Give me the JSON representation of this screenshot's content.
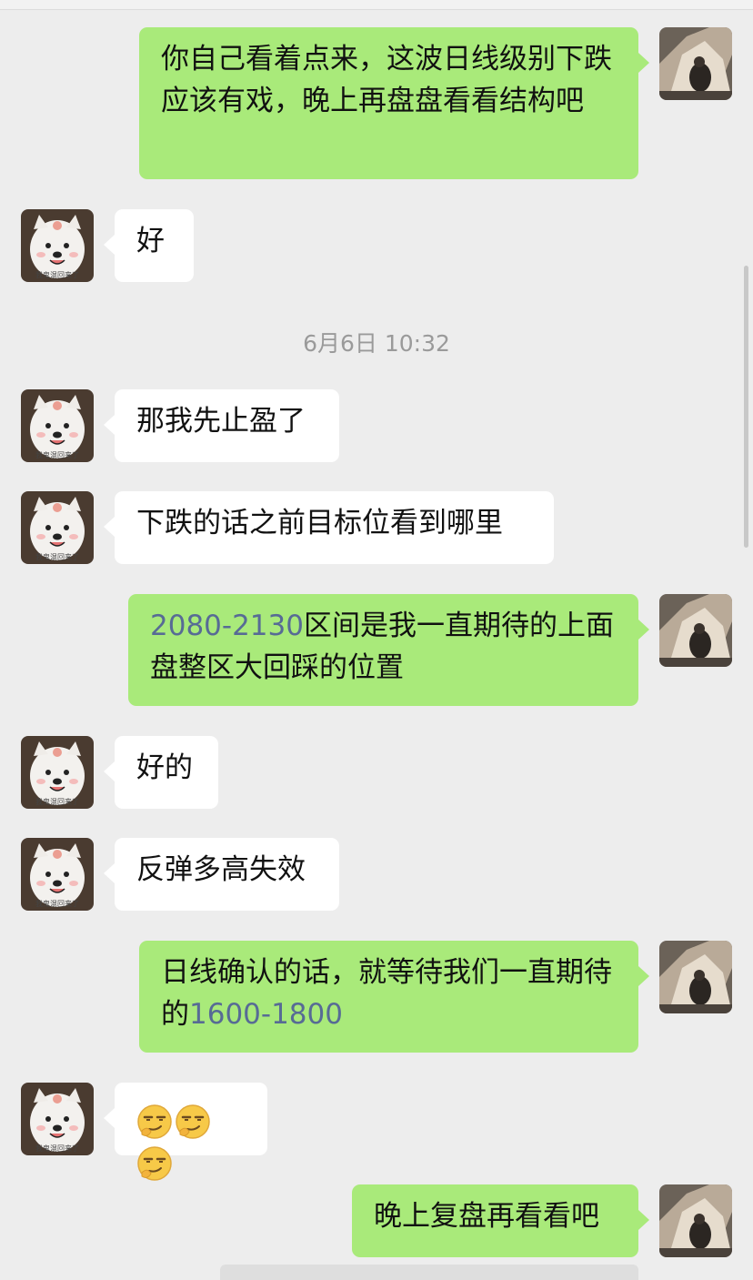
{
  "timestamp": "6月6日 10:32",
  "avatars": {
    "self_caption": "",
    "contact_caption": "我鬼混回来了"
  },
  "messages": [
    {
      "sender": "me",
      "text": "你自己看着点来，这波日线级别下跌应该有戏，晚上再盘盘看看结构吧"
    },
    {
      "sender": "contact",
      "text": "好"
    },
    {
      "sender": "contact",
      "text": "那我先止盈了"
    },
    {
      "sender": "contact",
      "text": "下跌的话之前目标位看到哪里"
    },
    {
      "sender": "me",
      "num": "2080-2130",
      "text": "区间是我一直期待的上面盘整区大回踩的位置"
    },
    {
      "sender": "contact",
      "text": "好的"
    },
    {
      "sender": "contact",
      "text": "反弹多高失效"
    },
    {
      "sender": "me",
      "text": "日线确认的话，就等待我们一直期待的",
      "num": "1600-1800"
    },
    {
      "sender": "contact",
      "emoji": [
        "smirk-emoji",
        "smirk-emoji",
        "smirk-emoji"
      ]
    },
    {
      "sender": "me",
      "text": "晚上复盘再看看吧"
    }
  ],
  "colors": {
    "outgoing_bubble": "#a9ea7a",
    "incoming_bubble": "#ffffff",
    "background": "#ededed",
    "number_link": "#576b95"
  }
}
